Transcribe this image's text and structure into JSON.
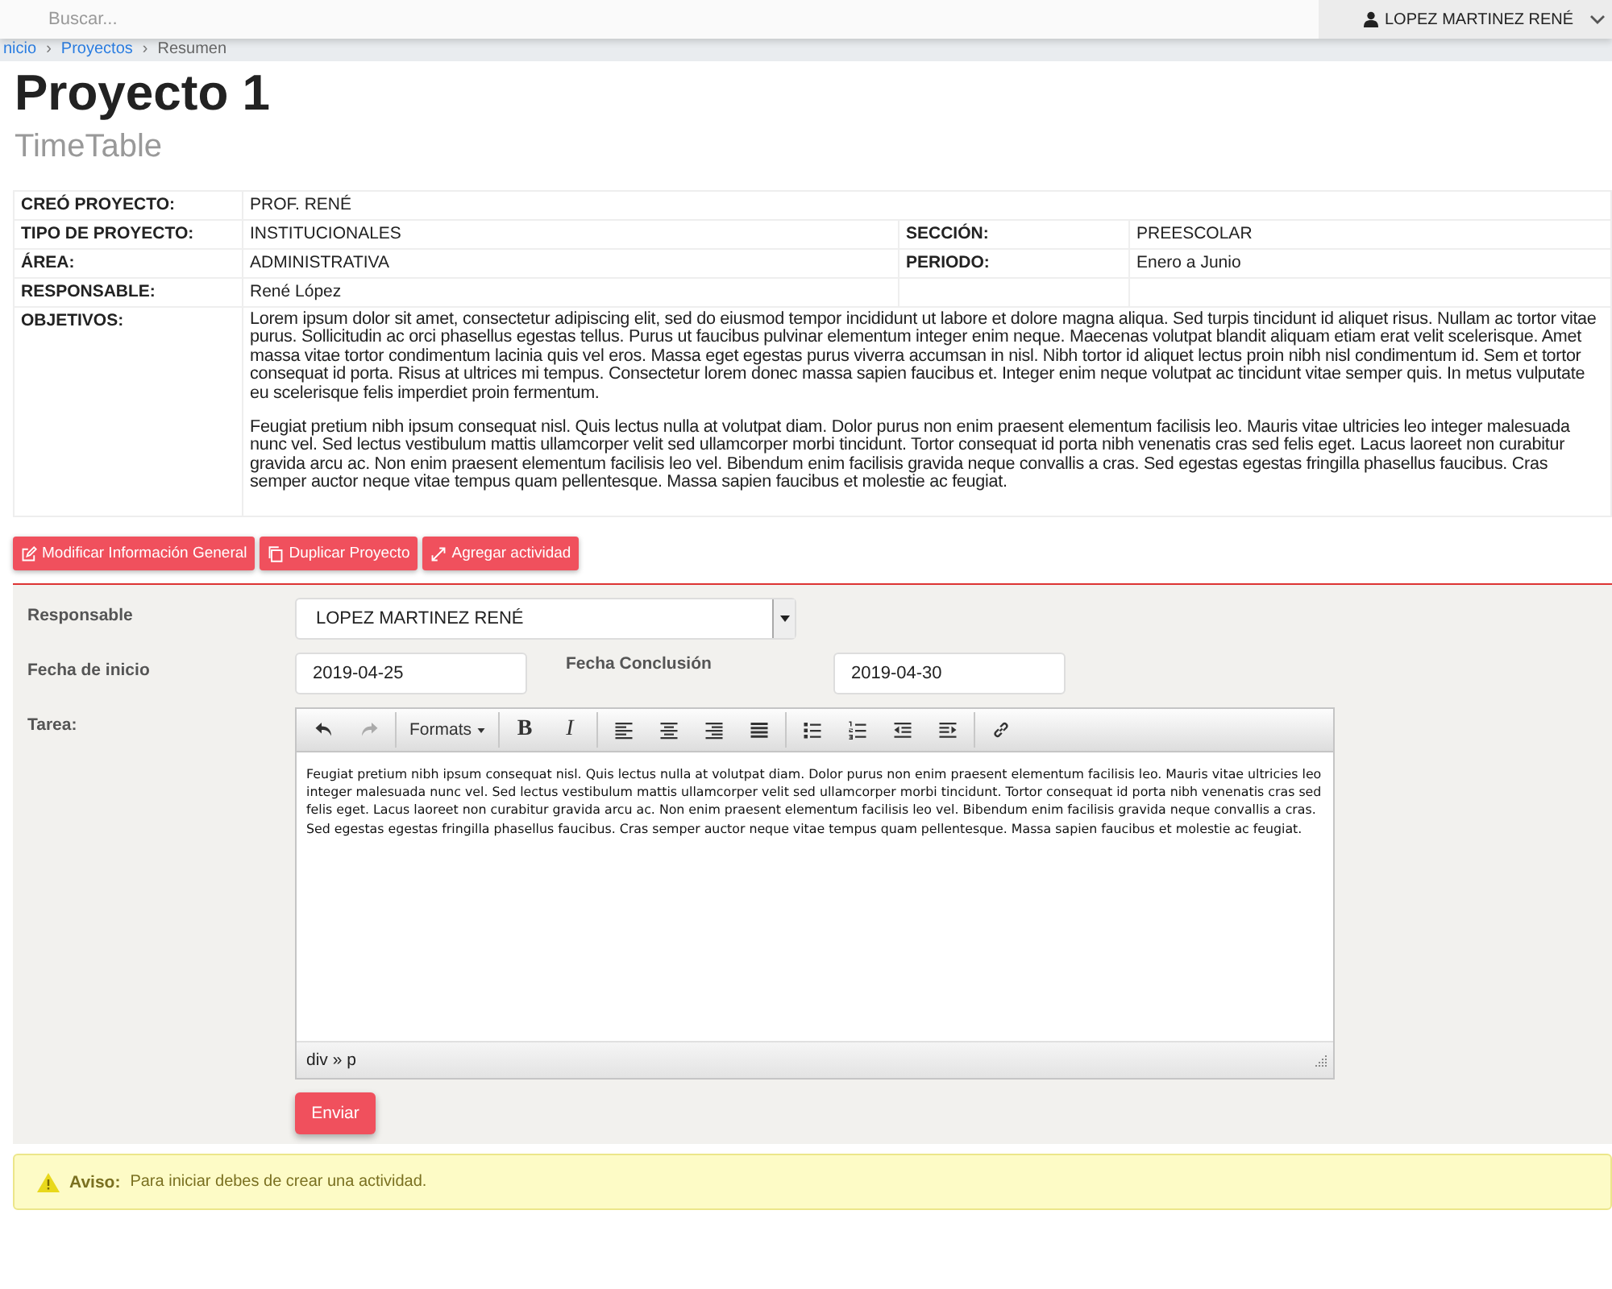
{
  "topbar": {
    "search": {
      "placeholder": "Buscar..."
    },
    "user": "LOPEZ MARTINEZ RENÉ"
  },
  "breadcrumb": [
    {
      "label": "nicio",
      "kind": "link"
    },
    {
      "label": "Proyectos",
      "kind": "link"
    },
    {
      "label": "Resumen",
      "kind": "current"
    }
  ],
  "breadcrumb_separator": "›",
  "title": "Proyecto 1",
  "subtitle": "TimeTable",
  "info_rows": [
    {
      "cells": [
        {
          "label": "CREÓ PROYECTO:",
          "value": "PROF. RENÉ"
        }
      ]
    },
    {
      "cells": [
        {
          "label": "TIPO DE PROYECTO:",
          "value": "INSTITUCIONALES"
        },
        {
          "label": "SECCIÓN:",
          "value": "PREESCOLAR"
        }
      ]
    },
    {
      "cells": [
        {
          "label": "ÁREA:",
          "value": "ADMINISTRATIVA"
        },
        {
          "label": "PERIODO:",
          "value": "Enero a Junio"
        }
      ]
    },
    {
      "cells": [
        {
          "label": "RESPONSABLE:",
          "value": "René López"
        },
        {}
      ]
    }
  ],
  "objectives": {
    "label": "OBJETIVOS:",
    "paragraphs": [
      "Lorem ipsum dolor sit amet, consectetur adipiscing elit, sed do eiusmod tempor incididunt ut labore et dolore magna aliqua. Sed turpis tincidunt id aliquet risus. Nullam ac tortor vitae purus. Sollicitudin ac orci phasellus egestas tellus. Purus ut faucibus pulvinar elementum integer enim neque. Maecenas volutpat blandit aliquam etiam erat velit scelerisque. Amet massa vitae tortor condimentum lacinia quis vel eros. Massa eget egestas purus viverra accumsan in nisl. Nibh tortor id aliquet lectus proin nibh nisl condimentum id. Sem et tortor consequat id porta. Risus at ultrices mi tempus. Consectetur lorem donec massa sapien faucibus et. Integer enim neque volutpat ac tincidunt vitae semper quis. In metus vulputate eu scelerisque felis imperdiet proin fermentum.",
      "Feugiat pretium nibh ipsum consequat nisl. Quis lectus nulla at volutpat diam. Dolor purus non enim praesent elementum facilisis leo. Mauris vitae ultricies leo integer malesuada nunc vel. Sed lectus vestibulum mattis ullamcorper velit sed ullamcorper morbi tincidunt. Tortor consequat id porta nibh venenatis cras sed felis eget. Lacus laoreet non curabitur gravida arcu ac. Non enim praesent elementum facilisis leo vel. Bibendum enim facilisis gravida neque convallis a cras. Sed egestas egestas fringilla phasellus faucibus. Cras semper auctor neque vitae tempus quam pellentesque. Massa sapien faucibus et molestie ac feugiat."
    ]
  },
  "actions": [
    {
      "label": "Modificar Información General",
      "kind": "edit"
    },
    {
      "label": "Duplicar Proyecto",
      "kind": "copy"
    },
    {
      "label": "Agregar actividad",
      "kind": "expand"
    }
  ],
  "form": {
    "responsable": {
      "label": "Responsable",
      "value": "LOPEZ MARTINEZ RENÉ"
    },
    "start": {
      "label": "Fecha de inicio",
      "value": "2019-04-25"
    },
    "end": {
      "label": "Fecha Conclusión",
      "value": "2019-04-30"
    },
    "task": {
      "label": "Tarea:",
      "toolbar": [
        {
          "kind": "undo",
          "disabled": false
        },
        {
          "kind": "redo",
          "disabled": true
        },
        {
          "kind": "sep"
        },
        {
          "kind": "formats",
          "label": "Formats",
          "disabled": false
        },
        {
          "kind": "sep"
        },
        {
          "kind": "bold",
          "label": "B",
          "disabled": false
        },
        {
          "kind": "italic",
          "label": "I",
          "disabled": false
        },
        {
          "kind": "sep"
        },
        {
          "kind": "align-left",
          "disabled": false
        },
        {
          "kind": "align-center",
          "disabled": false
        },
        {
          "kind": "align-right",
          "disabled": false
        },
        {
          "kind": "justify",
          "disabled": false
        },
        {
          "kind": "sep"
        },
        {
          "kind": "bullets",
          "disabled": false
        },
        {
          "kind": "numbers",
          "disabled": false
        },
        {
          "kind": "outdent",
          "disabled": false
        },
        {
          "kind": "indent",
          "disabled": false
        },
        {
          "kind": "sep"
        },
        {
          "kind": "link",
          "disabled": false
        }
      ],
      "content": "Feugiat pretium nibh ipsum consequat nisl. Quis lectus nulla at volutpat diam. Dolor purus non enim praesent elementum facilisis leo. Mauris vitae ultricies leo integer malesuada nunc vel. Sed lectus vestibulum mattis ullamcorper velit sed ullamcorper morbi tincidunt. Tortor consequat id porta nibh venenatis cras sed felis eget. Lacus laoreet non curabitur gravida arcu ac. Non enim praesent elementum facilisis leo vel. Bibendum enim facilisis gravida neque convallis a cras. Sed egestas egestas fringilla phasellus faucibus. Cras semper auctor neque vitae tempus quam pellentesque. Massa sapien faucibus et molestie ac feugiat.",
      "path": "div » p"
    },
    "submit": "Enviar"
  },
  "alert": {
    "title": "Aviso:",
    "message": "Para iniciar debes de crear una actividad."
  }
}
